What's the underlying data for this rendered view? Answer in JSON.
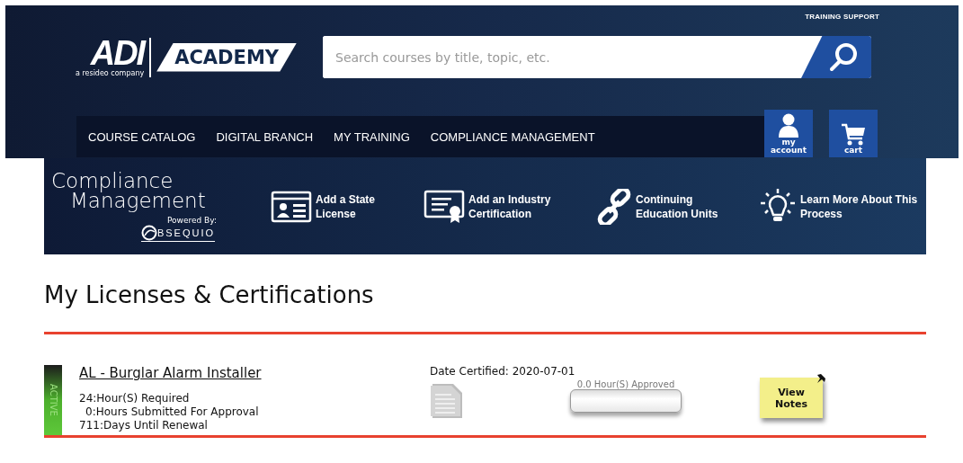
{
  "header": {
    "top_link": "TRAINING SUPPORT",
    "logo": {
      "brand": "ADI",
      "tagline": "a resideo company",
      "academy": "ACADEMY"
    },
    "search": {
      "placeholder": "Search courses by title, topic, etc."
    },
    "nav": [
      {
        "label": "COURSE CATALOG"
      },
      {
        "label": "DIGITAL BRANCH"
      },
      {
        "label": "MY TRAINING"
      },
      {
        "label": "COMPLIANCE MANAGEMENT"
      }
    ],
    "account_buttons": [
      {
        "kind": "account",
        "label": "my account"
      },
      {
        "kind": "cart",
        "label": "cart"
      }
    ]
  },
  "banner": {
    "title_line_1": "Compliance",
    "title_line_2": "Management",
    "powered_by": "Powered By:",
    "partner": "BSEQUIO",
    "actions": [
      {
        "kind": "license",
        "label": "Add a State License"
      },
      {
        "kind": "certificate",
        "label": "Add an Industry Certification"
      },
      {
        "kind": "link",
        "label": "Continuing Education Units"
      },
      {
        "kind": "bulb",
        "label": "Learn More About This Process"
      }
    ]
  },
  "page_title": "My Licenses & Certifications",
  "licenses": [
    {
      "status": "ACTIVE",
      "title": "AL - Burglar Alarm Installer",
      "details": [
        "24:Hour(S) Required",
        "0:Hours Submitted For Approval",
        "711:Days Until Renewal"
      ],
      "date_certified": "Date Certified: 2020-07-01",
      "approved_label": "0.0 Hour(S) Approved",
      "level": 0,
      "notes_button": "View Notes"
    }
  ]
}
